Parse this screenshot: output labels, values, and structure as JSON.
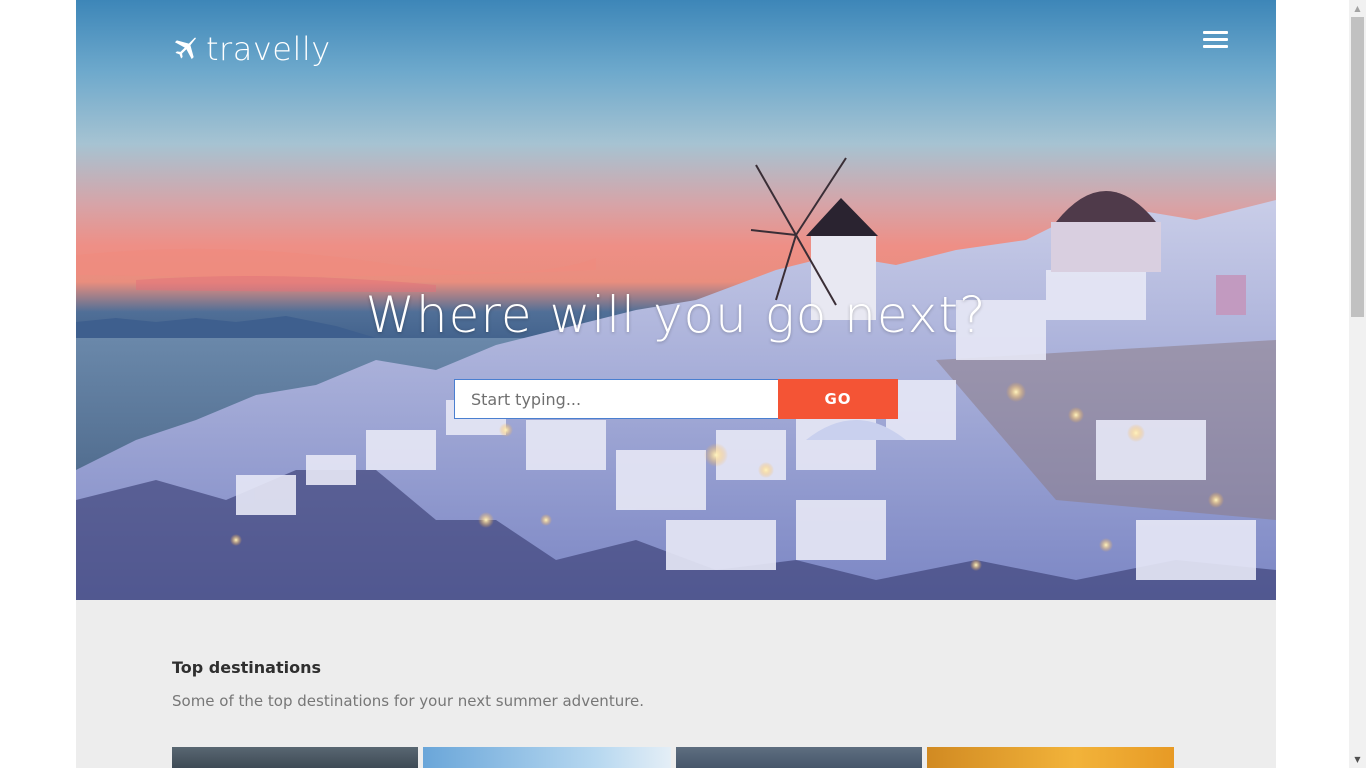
{
  "header": {
    "logo_text": "travelly",
    "logo_icon": "airplane-icon",
    "menu_icon": "hamburger-menu-icon"
  },
  "hero": {
    "headline": "Where will you go next?",
    "search": {
      "placeholder": "Start typing...",
      "value": "",
      "button_label": "GO"
    }
  },
  "destinations": {
    "title": "Top destinations",
    "subtitle": "Some of the top destinations for your next summer adventure."
  },
  "colors": {
    "accent": "#f45435",
    "section_bg": "#ededed"
  }
}
